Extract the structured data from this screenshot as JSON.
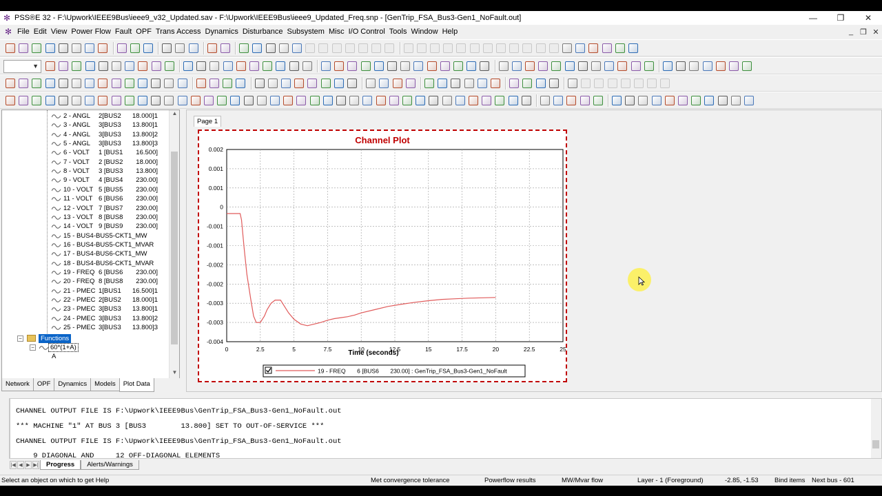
{
  "window": {
    "title": "PSS®E 32 - F:\\Upwork\\IEEE9Bus\\ieee9_v32_Updated.sav - F:\\Upwork\\IEEE9Bus\\ieee9_Updated_Freq.snp - [GenTrip_FSA_Bus3-Gen1_NoFault.out]",
    "minimize": "—",
    "maximize": "❐",
    "close": "✕",
    "mdi_minimize": "_",
    "mdi_restore": "❐",
    "mdi_close": "✕"
  },
  "menu": [
    "File",
    "Edit",
    "View",
    "Power Flow",
    "Fault",
    "OPF",
    "Trans Access",
    "Dynamics",
    "Disturbance",
    "Subsystem",
    "Misc",
    "I/O Control",
    "Tools",
    "Window",
    "Help"
  ],
  "channels": [
    {
      "name": "2 - ANGL",
      "bus": "2[BUS2",
      "value": "18.000]1"
    },
    {
      "name": "3 - ANGL",
      "bus": "3[BUS3",
      "value": "13.800]1"
    },
    {
      "name": "4 - ANGL",
      "bus": "3[BUS3",
      "value": "13.800]2"
    },
    {
      "name": "5 - ANGL",
      "bus": "3[BUS3",
      "value": "13.800]3"
    },
    {
      "name": "6 - VOLT",
      "bus": "1 [BUS1",
      "value": "16.500]"
    },
    {
      "name": "7 - VOLT",
      "bus": "2 [BUS2",
      "value": "18.000]"
    },
    {
      "name": "8 - VOLT",
      "bus": "3 [BUS3",
      "value": "13.800]"
    },
    {
      "name": "9 - VOLT",
      "bus": "4 [BUS4",
      "value": "230.00]"
    },
    {
      "name": "10 - VOLT",
      "bus": "5 [BUS5",
      "value": "230.00]"
    },
    {
      "name": "11 - VOLT",
      "bus": "6 [BUS6",
      "value": "230.00]"
    },
    {
      "name": "12 - VOLT",
      "bus": "7 [BUS7",
      "value": "230.00]"
    },
    {
      "name": "13 - VOLT",
      "bus": "8 [BUS8",
      "value": "230.00]"
    },
    {
      "name": "14 - VOLT",
      "bus": "9 [BUS9",
      "value": "230.00]"
    },
    {
      "name": "15 - BUS4-BUS5-CKT1_MW",
      "bus": "",
      "value": ""
    },
    {
      "name": "16 - BUS4-BUS5-CKT1_MVAR",
      "bus": "",
      "value": ""
    },
    {
      "name": "17 - BUS4-BUS6-CKT1_MW",
      "bus": "",
      "value": ""
    },
    {
      "name": "18 - BUS4-BUS6-CKT1_MVAR",
      "bus": "",
      "value": ""
    },
    {
      "name": "19 - FREQ",
      "bus": "6 [BUS6",
      "value": "230.00]"
    },
    {
      "name": "20 - FREQ",
      "bus": "8 [BUS8",
      "value": "230.00]"
    },
    {
      "name": "21 - PMEC",
      "bus": "1[BUS1",
      "value": "16.500]1"
    },
    {
      "name": "22 - PMEC",
      "bus": "2[BUS2",
      "value": "18.000]1"
    },
    {
      "name": "23 - PMEC",
      "bus": "3[BUS3",
      "value": "13.800]1"
    },
    {
      "name": "24 - PMEC",
      "bus": "3[BUS3",
      "value": "13.800]2"
    },
    {
      "name": "25 - PMEC",
      "bus": "3[BUS3",
      "value": "13.800]3"
    }
  ],
  "tree": {
    "functions_label": "Functions",
    "function_item": "60*(1+A)",
    "function_arg": "A",
    "collapse_sign": "−"
  },
  "left_tabs": [
    "Network",
    "OPF",
    "Dynamics",
    "Models",
    "Plot Data"
  ],
  "left_tab_active": "Plot Data",
  "page_tab": "Page 1",
  "chart_data": {
    "type": "line",
    "title": "Channel Plot",
    "xlabel": "Time (seconds)",
    "ylabel": "",
    "xlim": [
      0,
      25
    ],
    "ylim": [
      -0.004,
      0.002
    ],
    "x_ticks": [
      "0",
      "2.5",
      "5",
      "7.5",
      "10",
      "12.5",
      "15",
      "17.5",
      "20",
      "22.5",
      "25"
    ],
    "y_ticks": [
      "0.002",
      "0.001",
      "0.001",
      "0",
      "-0.001",
      "-0.001",
      "-0.002",
      "-0.002",
      "-0.003",
      "-0.003",
      "-0.004"
    ],
    "grid": true,
    "color": "#e05a5a",
    "series": [
      {
        "name": "19 - FREQ       6 [BUS6       230.00] : GenTrip_FSA_Bus3-Gen1_NoFault",
        "x": [
          0,
          0.5,
          1.0,
          1.1,
          1.3,
          1.5,
          1.8,
          2.0,
          2.2,
          2.5,
          2.8,
          3.0,
          3.3,
          3.6,
          4.0,
          4.3,
          4.6,
          5.0,
          5.5,
          6.0,
          6.5,
          7.0,
          7.5,
          8.0,
          8.5,
          9.0,
          9.5,
          10,
          11,
          12,
          13,
          14,
          15,
          16,
          17,
          18,
          19,
          20
        ],
        "y": [
          0,
          0,
          0,
          -0.0002,
          -0.0011,
          -0.0019,
          -0.0027,
          -0.0032,
          -0.0034,
          -0.0034,
          -0.0032,
          -0.003,
          -0.0028,
          -0.0027,
          -0.0027,
          -0.0029,
          -0.0031,
          -0.0033,
          -0.00345,
          -0.0035,
          -0.00345,
          -0.0034,
          -0.00333,
          -0.00328,
          -0.00325,
          -0.00322,
          -0.00317,
          -0.0031,
          -0.003,
          -0.0029,
          -0.00283,
          -0.00277,
          -0.00272,
          -0.00268,
          -0.00266,
          -0.00264,
          -0.00263,
          -0.00262
        ]
      }
    ],
    "legend": {
      "placement": "bottom-center",
      "checked": true,
      "text": "19 - FREQ       6 [BUS6       230.00] : GenTrip_FSA_Bus3-Gen1_NoFault"
    }
  },
  "output_lines": [
    "CHANNEL OUTPUT FILE IS F:\\Upwork\\IEEE9Bus\\GenTrip_FSA_Bus3-Gen1_NoFault.out",
    "*** MACHINE \"1\" AT BUS 3 [BUS3        13.800] SET TO OUT-OF-SERVICE ***",
    "CHANNEL OUTPUT FILE IS F:\\Upwork\\IEEE9Bus\\GenTrip_FSA_Bus3-Gen1_NoFault.out",
    "    9 DIAGONAL AND     12 OFF-DIAGONAL ELEMENTS"
  ],
  "output_tabs": [
    "Progress",
    "Alerts/Warnings"
  ],
  "status": {
    "hint": "Select an object on which to get Help",
    "convergence": "Met convergence tolerance",
    "powerflow": "Powerflow results",
    "flow": "MW/Mvar flow",
    "layer": "Layer - 1 (Foreground)",
    "coords": "-2.85, -1.53",
    "bind": "Bind items",
    "nextbus": "Next bus - 601"
  },
  "colors": {
    "accent": "#0a64c8",
    "plot_border": "#c00000",
    "trace": "#e05a5a",
    "title": "#c00000"
  }
}
